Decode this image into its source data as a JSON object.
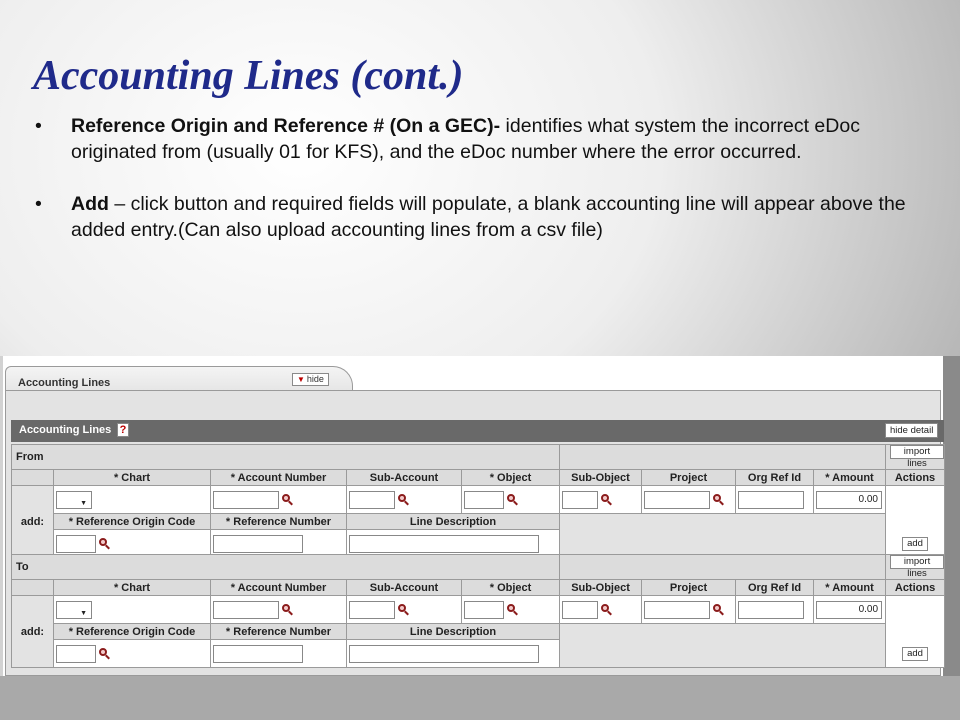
{
  "slide": {
    "title": "Accounting Lines (cont.)",
    "bullets": [
      {
        "bold": "Reference Origin and Reference # (On a GEC)-",
        "text": " identifies what system the incorrect eDoc originated from (usually 01 for KFS), and the eDoc number where the error occurred."
      },
      {
        "bold": "Add",
        "text": " – click button and required fields will populate, a blank accounting line will appear above the added entry.(Can also upload accounting lines from a csv file)"
      }
    ],
    "bullet_char": "•"
  },
  "ui": {
    "tab_label": "Accounting Lines",
    "hide_button": "hide",
    "section_title": "Accounting Lines",
    "help_icon": "?",
    "hide_detail_button": "hide detail",
    "columns_top": [
      "* Chart",
      "* Account Number",
      "Sub-Account",
      "* Object",
      "Sub-Object",
      "Project",
      "Org Ref Id",
      "* Amount",
      "Actions"
    ],
    "columns_bottom": [
      "* Reference Origin Code",
      "* Reference Number",
      "Line Description"
    ],
    "add_row_label": "add:",
    "import_button": "import lines",
    "add_button": "add",
    "groups": [
      {
        "label": "From",
        "amount": "0.00"
      },
      {
        "label": "To",
        "amount": "0.00"
      }
    ],
    "icons": {
      "lookup": "magnifier-icon",
      "dropdown": "chevron-down-icon",
      "hide_toggle": "triangle-down-icon"
    }
  }
}
